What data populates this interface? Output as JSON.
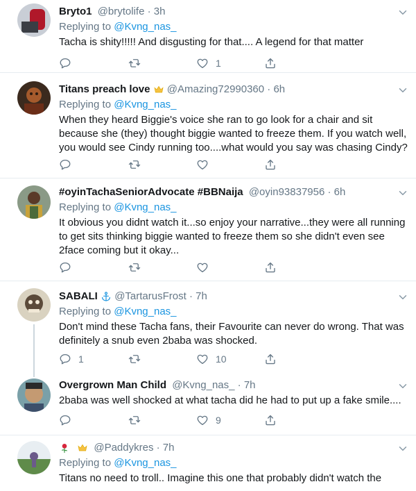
{
  "tweets": [
    {
      "name": "Bryto1",
      "handle": "@brytolife",
      "time": "3h",
      "replying_prefix": "Replying to",
      "replying_to": "@Kvng_nas_",
      "text": "Tacha is shity!!!!! And disgusting for that.... A legend for that matter",
      "replies": "",
      "retweets": "",
      "likes": "1"
    },
    {
      "name": "Titans preach love",
      "handle": "@Amazing72990360",
      "time": "6h",
      "replying_prefix": "Replying to",
      "replying_to": "@Kvng_nas_",
      "text_lines": [
        "When they heard Biggie's voice she ran to go look for a chair and sit",
        "because she (they) thought  biggie wanted to freeze them. If you watch well,",
        "you would see Cindy running too....what would you say was chasing Cindy?"
      ],
      "replies": "",
      "retweets": "",
      "likes": ""
    },
    {
      "name": "#oyinTachaSeniorAdvocate #BBNaija",
      "handle": "@oyin93837956",
      "time": "6h",
      "replying_prefix": "Replying to",
      "replying_to": "@Kvng_nas_",
      "text_lines": [
        "It obvious you didnt watch it...so enjoy your narrative...they were all running",
        "to get sits thinking biggie wanted to freeze them so she didn't even see",
        "2face coming but it okay..."
      ],
      "replies": "",
      "retweets": "",
      "likes": ""
    },
    {
      "name": "SABALI",
      "handle": "@TartarusFrost",
      "time": "7h",
      "replying_prefix": "Replying to",
      "replying_to": "@Kvng_nas_",
      "text_lines": [
        "Don't mind these Tacha fans, their Favourite can never do wrong. That was",
        "definitely a snub even 2baba was shocked."
      ],
      "replies": "1",
      "retweets": "",
      "likes": "10"
    },
    {
      "name": "Overgrown Man Child",
      "handle": "@Kvng_nas_",
      "time": "7h",
      "text": "2baba was well shocked at what tacha did he had to put up a fake smile....",
      "replies": "",
      "retweets": "",
      "likes": "9"
    },
    {
      "name": "",
      "handle": "@Paddykres",
      "time": "7h",
      "replying_prefix": "Replying to",
      "replying_to": "@Kvng_nas_",
      "text": "Titans no need to troll.. Imagine this one that probably didn't watch the"
    }
  ],
  "separator": "·",
  "colors": {
    "link": "#1b95e0",
    "muted": "#657786",
    "text": "#14171a",
    "border": "#e6ecf0",
    "thread_line": "#ccd6dd"
  },
  "icons": [
    "chevron-down-icon",
    "reply-icon",
    "retweet-icon",
    "like-icon",
    "share-icon",
    "crown-icon",
    "anchor-icon",
    "rose-icon"
  ]
}
